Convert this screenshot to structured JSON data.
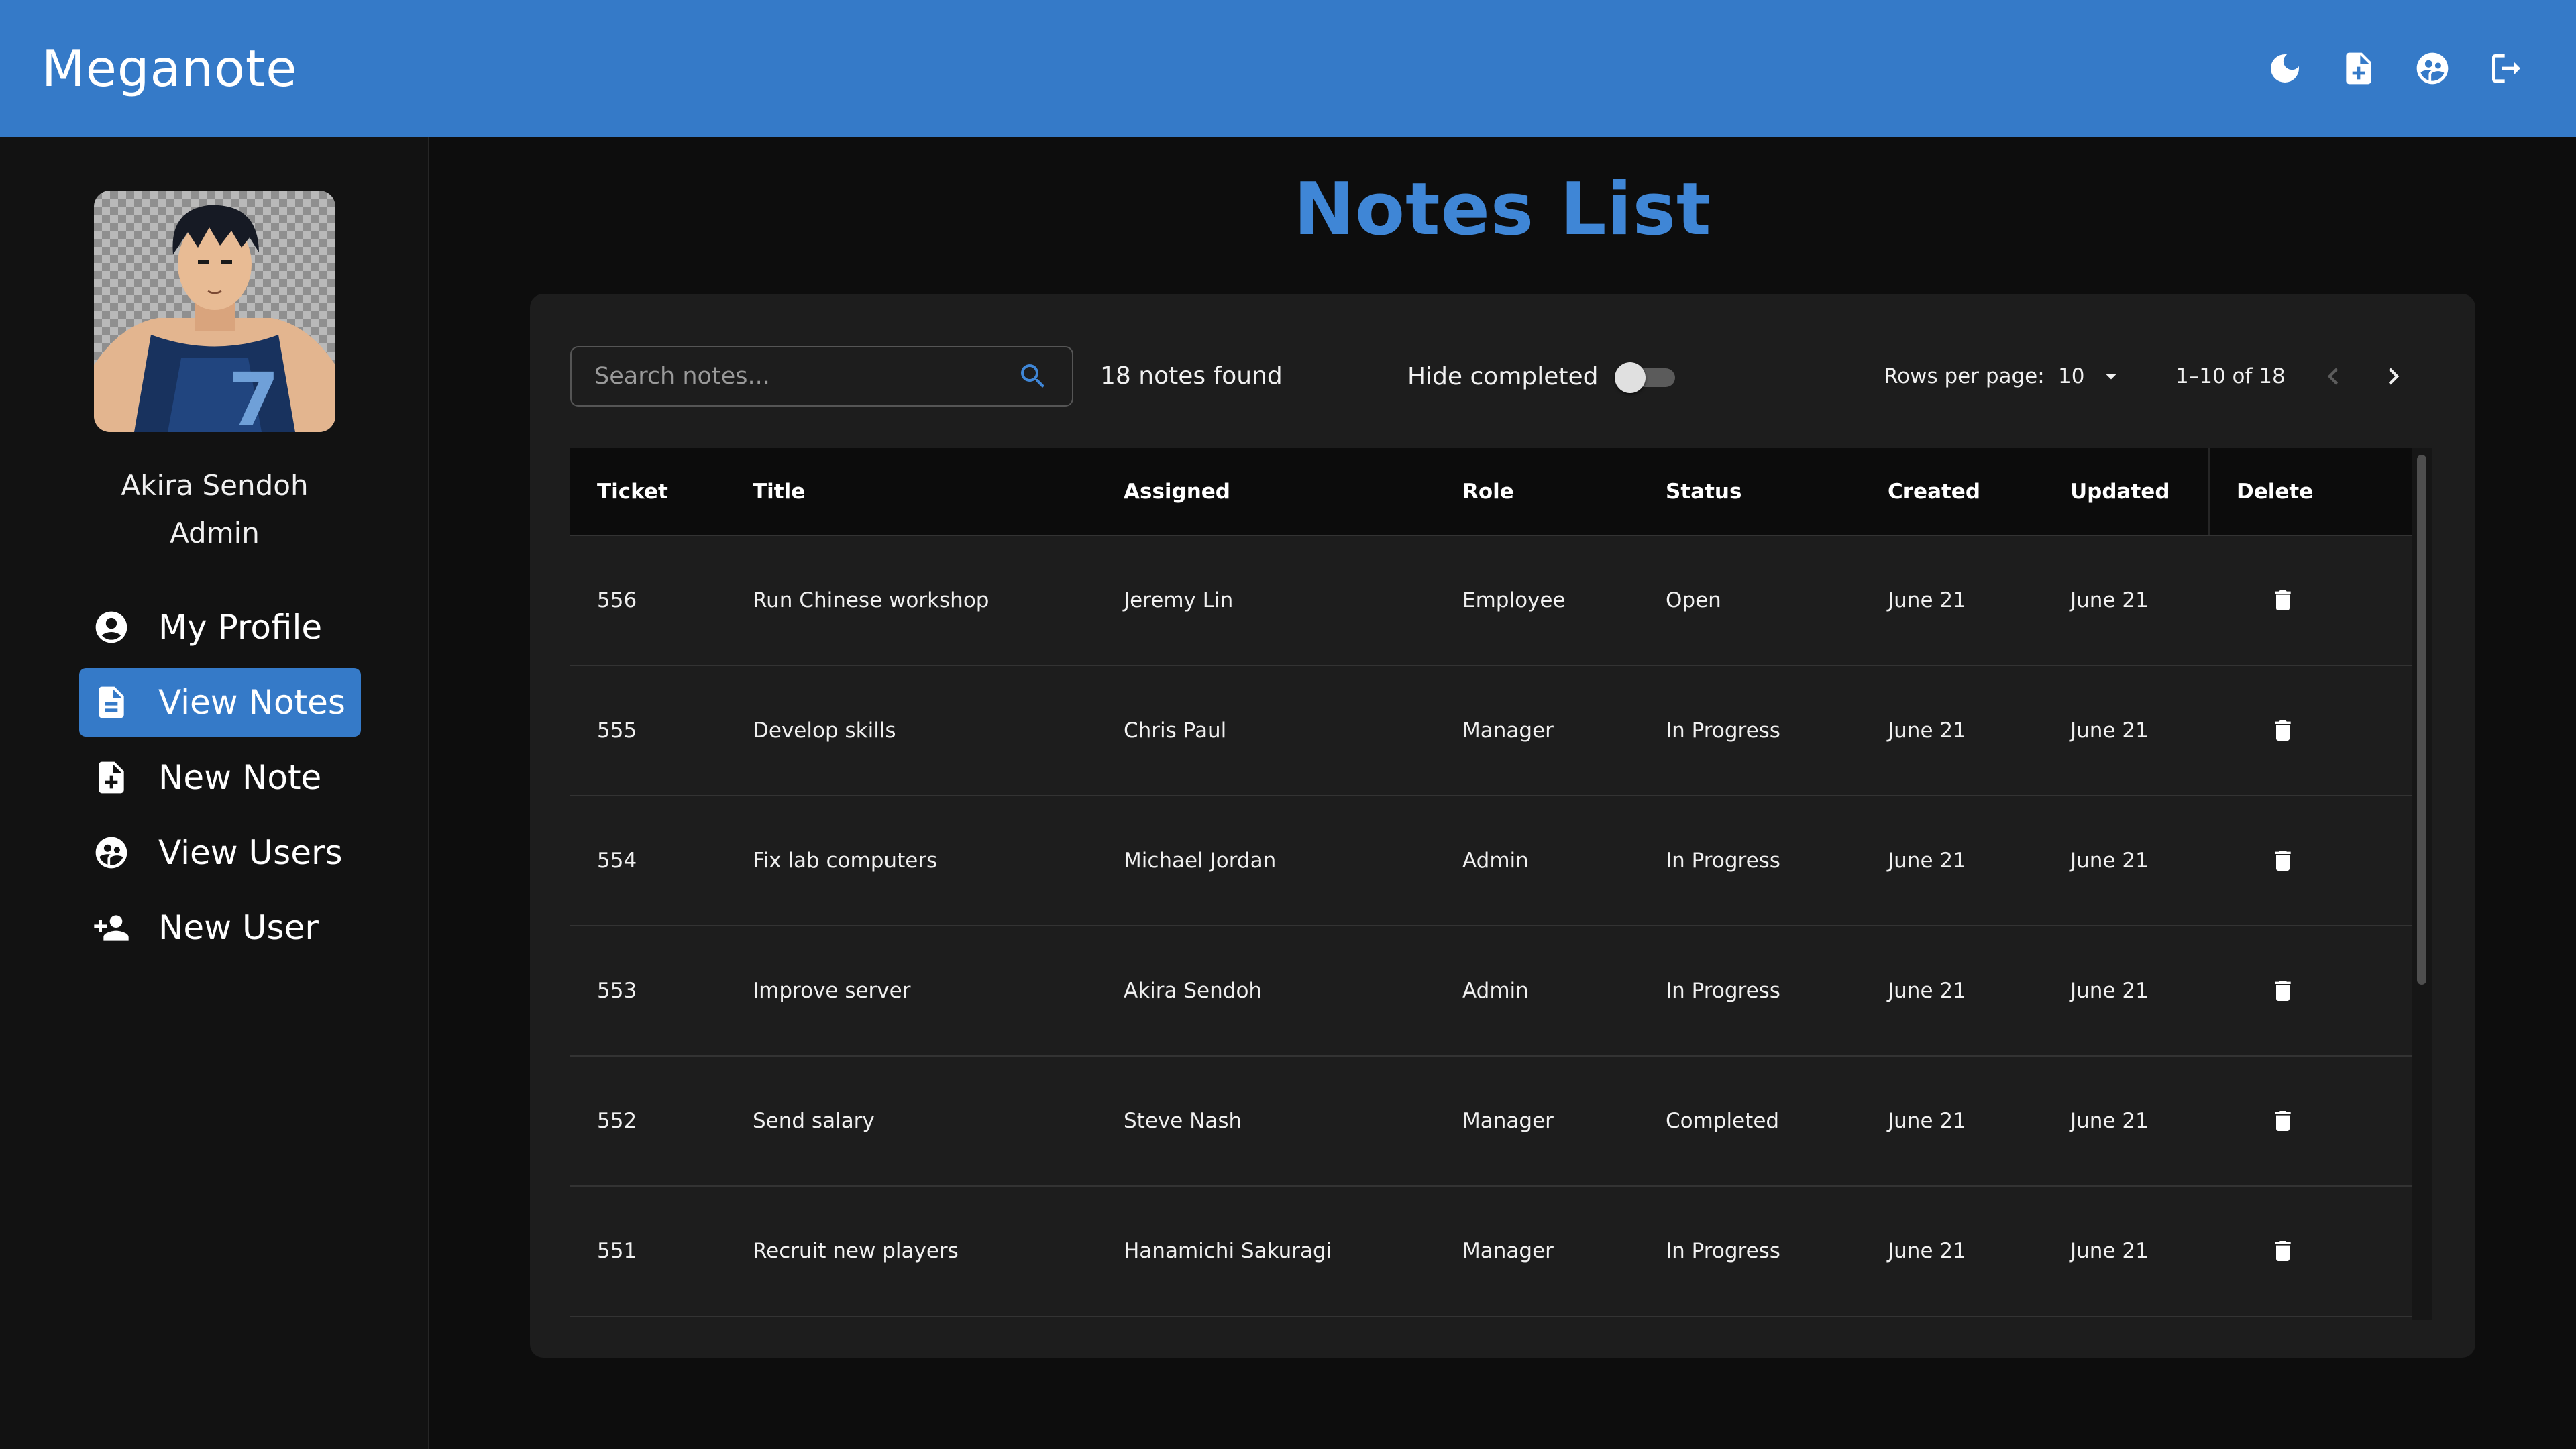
{
  "app": {
    "title": "Meganote"
  },
  "appbar": {
    "actions": [
      {
        "name": "theme-toggle-button",
        "icon": "moon-icon"
      },
      {
        "name": "new-note-button",
        "icon": "note-add-icon"
      },
      {
        "name": "users-button",
        "icon": "users-icon"
      },
      {
        "name": "logout-button",
        "icon": "logout-icon"
      }
    ]
  },
  "colors": {
    "accent": "#357ac8",
    "title": "#3f86d6",
    "background": "#0d0d0d",
    "card": "#1d1d1d"
  },
  "user": {
    "name": "Akira Sendoh",
    "role": "Admin"
  },
  "sidebar": {
    "items": [
      {
        "label": "My Profile",
        "icon": "account-circle-icon",
        "active": false
      },
      {
        "label": "View Notes",
        "icon": "document-icon",
        "active": true
      },
      {
        "label": "New Note",
        "icon": "note-add-icon",
        "active": false
      },
      {
        "label": "View Users",
        "icon": "users-icon",
        "active": false
      },
      {
        "label": "New User",
        "icon": "person-add-icon",
        "active": false
      }
    ]
  },
  "main": {
    "title": "Notes List",
    "search": {
      "placeholder": "Search notes...",
      "value": ""
    },
    "found": "18 notes found",
    "hide_completed": {
      "label": "Hide completed",
      "checked": false
    },
    "pagination": {
      "rows_label": "Rows per page:",
      "rows_value": "10",
      "range": "1–10 of 18"
    },
    "table": {
      "headers": [
        "Ticket",
        "Title",
        "Assigned",
        "Role",
        "Status",
        "Created",
        "Updated",
        "Delete"
      ],
      "rows": [
        {
          "ticket": "556",
          "title": "Run Chinese workshop",
          "assigned": "Jeremy Lin",
          "role": "Employee",
          "status": "Open",
          "created": "June 21",
          "updated": "June 21"
        },
        {
          "ticket": "555",
          "title": "Develop skills",
          "assigned": "Chris Paul",
          "role": "Manager",
          "status": "In Progress",
          "created": "June 21",
          "updated": "June 21"
        },
        {
          "ticket": "554",
          "title": "Fix lab computers",
          "assigned": "Michael Jordan",
          "role": "Admin",
          "status": "In Progress",
          "created": "June 21",
          "updated": "June 21"
        },
        {
          "ticket": "553",
          "title": "Improve server",
          "assigned": "Akira Sendoh",
          "role": "Admin",
          "status": "In Progress",
          "created": "June 21",
          "updated": "June 21"
        },
        {
          "ticket": "552",
          "title": "Send salary",
          "assigned": "Steve Nash",
          "role": "Manager",
          "status": "Completed",
          "created": "June 21",
          "updated": "June 21"
        },
        {
          "ticket": "551",
          "title": "Recruit new players",
          "assigned": "Hanamichi Sakuragi",
          "role": "Manager",
          "status": "In Progress",
          "created": "June 21",
          "updated": "June 21"
        }
      ]
    }
  }
}
